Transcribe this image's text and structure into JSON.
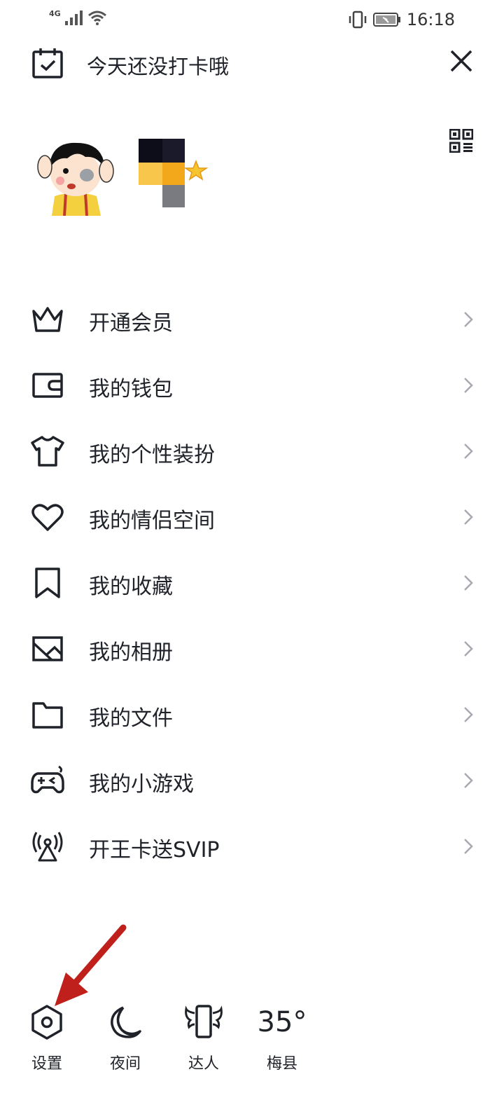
{
  "status_bar": {
    "network": "4G",
    "time": "16:18"
  },
  "header": {
    "checkin_text": "今天还没打卡哦"
  },
  "menu": {
    "items": [
      {
        "label": "开通会员",
        "icon": "crown-icon"
      },
      {
        "label": "我的钱包",
        "icon": "wallet-icon"
      },
      {
        "label": "我的个性装扮",
        "icon": "tshirt-icon"
      },
      {
        "label": "我的情侣空间",
        "icon": "heart-icon"
      },
      {
        "label": "我的收藏",
        "icon": "bookmark-icon"
      },
      {
        "label": "我的相册",
        "icon": "photo-icon"
      },
      {
        "label": "我的文件",
        "icon": "folder-icon"
      },
      {
        "label": "我的小游戏",
        "icon": "gamepad-icon"
      },
      {
        "label": "开王卡送SVIP",
        "icon": "broadcast-icon"
      }
    ]
  },
  "bottom_bar": {
    "settings_label": "设置",
    "night_label": "夜间",
    "expert_label": "达人",
    "temperature": "35°",
    "city": "梅县"
  },
  "colors": {
    "text": "#1f2329",
    "annotation_arrow": "#c0201b"
  }
}
